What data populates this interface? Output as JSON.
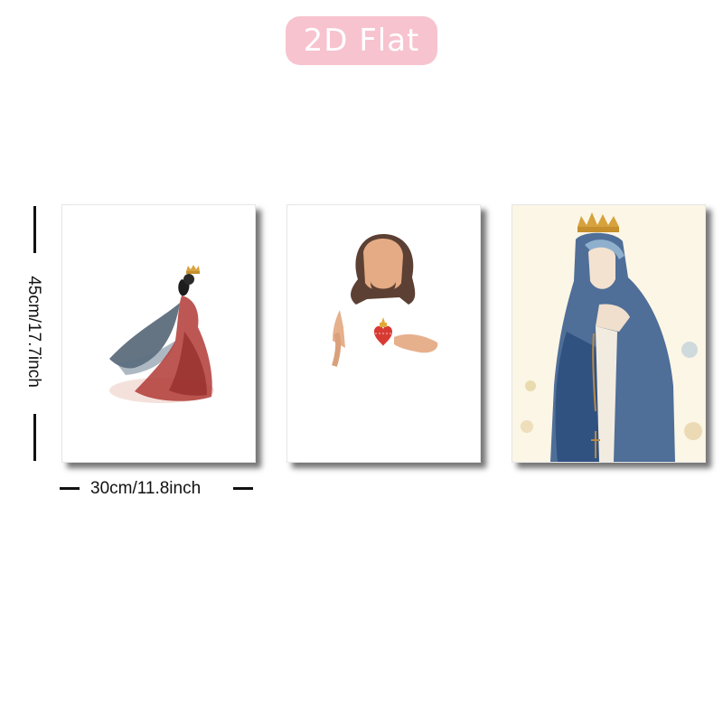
{
  "badge": {
    "label": "2D Flat",
    "color": "#f7c3cf"
  },
  "dimensions": {
    "height": "45cm/17.7inch",
    "width": "30cm/11.8inch"
  },
  "panels": [
    {
      "subject": "queen in red gown watercolor"
    },
    {
      "subject": "Sacred Heart figure watercolor"
    },
    {
      "subject": "crowned Virgin Mary in blue veil watercolor"
    }
  ]
}
